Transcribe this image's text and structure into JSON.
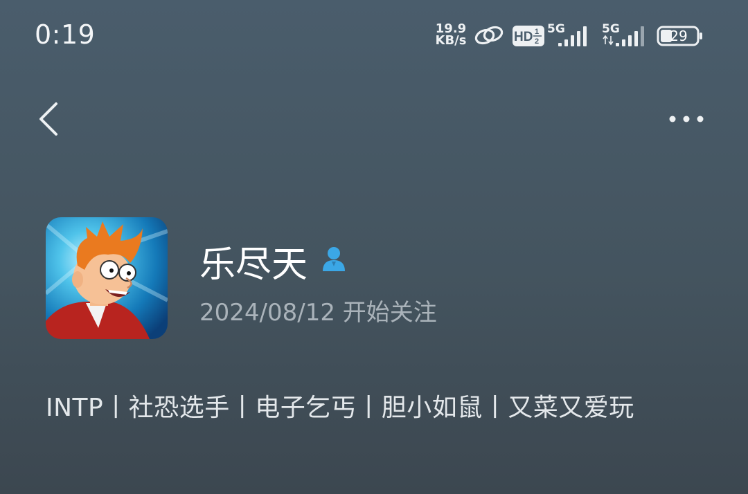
{
  "status_bar": {
    "time": "0:19",
    "net_speed_value": "19.9",
    "net_speed_unit": "KB/s",
    "hd_label": "HD",
    "hd_sub_top": "1",
    "hd_sub_bottom": "2",
    "sim1_label": "5G",
    "sim2_label": "5G",
    "battery_level": "29",
    "icons": [
      "link-icon",
      "hd-voice-icon",
      "signal-icon",
      "signal-icon",
      "battery-icon"
    ]
  },
  "nav": {
    "back_icon": "chevron-left-icon",
    "more_icon": "more-horizontal-icon"
  },
  "profile": {
    "name": "乐尽天",
    "name_badge_icon": "user-icon",
    "follow_since": "2024/08/12 开始关注",
    "bio": "INTP丨社恐选手丨电子乞丐丨胆小如鼠丨又菜又爱玩"
  },
  "colors": {
    "background_top": "#4a5d6c",
    "background_bottom": "#3c4750",
    "badge_blue": "#3ba7e6",
    "secondary_text": "#aab3ba"
  }
}
